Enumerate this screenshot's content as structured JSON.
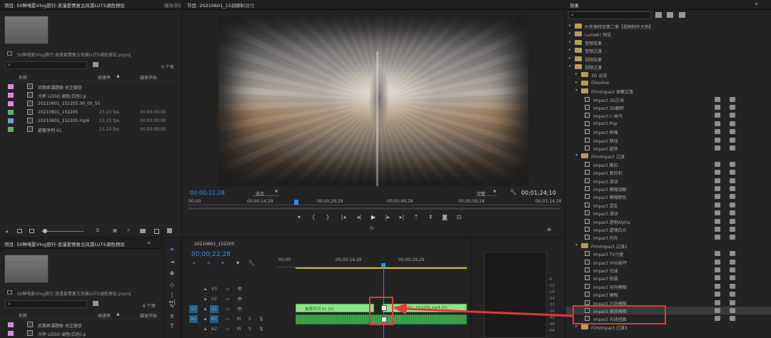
{
  "project": {
    "tab_project": "项目: 50种电影Vlog旅行·浪漫爱情复古风景LUTS调色预设",
    "tab_media": "媒体浏览器",
    "file": "50种电影Vlog旅行·浪漫爱情复古风景LUTS调色预设.prproj",
    "count": "6 个项",
    "columns": {
      "name": "名称",
      "frame_rate": "帧速率",
      "start": "媒体开始"
    },
    "items": [
      {
        "color": "#d78ad6",
        "icon": "file-icon",
        "name": "后期君课题联·关注微信",
        "rate": "",
        "start": ""
      },
      {
        "color": "#d78ad6",
        "icon": "file-icon",
        "name": "大杯 LOGO 调色(白色).p",
        "rate": "",
        "start": ""
      },
      {
        "color": "#d78ad6",
        "icon": "file-icon",
        "name": "20210601_152205.00_00_55",
        "rate": "",
        "start": ""
      },
      {
        "color": "#56b864",
        "icon": "sequence-icon",
        "name": "20210601_152205",
        "rate": "23.23 fps",
        "start": "00;00;00;00"
      },
      {
        "color": "#6aa0d8",
        "icon": "video-icon",
        "name": "20210601_152205.mp4",
        "rate": "23.23 fps",
        "start": "00;00;00;00"
      },
      {
        "color": "#56b864",
        "icon": "sequence-icon",
        "name": "嵌套序列 01",
        "rate": "23.23 fps",
        "start": "00;00;00;00"
      }
    ]
  },
  "program": {
    "tab_program": "节目: 20210601_152205",
    "tab_meta": "旧素材属性",
    "timecode": "00;00;22;28",
    "fit": "适合",
    "quality": "完整",
    "duration": "00;01;24;10",
    "ruler": [
      "00;00",
      "00;00;14;29",
      "00;00;29;29",
      "00;00;44;28",
      "00;00;59;28",
      "00;01;14;29"
    ]
  },
  "project2": {
    "tab": "项目: 50种电影Vlog旅行·浪漫爱情复古风景LUTS调色预设",
    "file": "50种电影Vlog旅行·浪漫爱情复古风景LUTS调色预设.prproj",
    "count": "6 个项",
    "columns": {
      "name": "名称",
      "frame_rate": "帧速率",
      "start": "媒体开始"
    },
    "items": [
      {
        "color": "#d78ad6",
        "name": "后期君课题联·关注微信"
      },
      {
        "color": "#d78ad6",
        "name": "大杯 LOGO 调色(白色).p"
      }
    ]
  },
  "timeline": {
    "tab": "20210601_152205",
    "timecode": "00;00;22;28",
    "ruler": [
      "00;00",
      "00;00;14;29",
      "00;00;29;29"
    ],
    "tracks": [
      {
        "id": "V3",
        "target": ""
      },
      {
        "id": "V2",
        "target": ""
      },
      {
        "id": "V1",
        "target": "V1"
      },
      {
        "id": "A1",
        "target": "A1"
      },
      {
        "id": "A2",
        "target": ""
      }
    ],
    "clip_label": "嵌套序列 01 [V]",
    "clip_label2": "20210601_152205.mp4 [V]",
    "meter": [
      "-6",
      "-12",
      "-18",
      "-24",
      "-30",
      "-36",
      "-42",
      "-48",
      "-54"
    ]
  },
  "effects": {
    "title": "效果",
    "tree": [
      {
        "level": 0,
        "label": "Pr先锋特效第二季【视频制作大师】"
      },
      {
        "level": 0,
        "label": "Lumetri 预设"
      },
      {
        "level": 0,
        "label": "音频效果"
      },
      {
        "level": 0,
        "label": "音频过渡"
      },
      {
        "level": 0,
        "label": "视频效果"
      },
      {
        "level": 0,
        "label": "视频过渡",
        "open": true
      },
      {
        "level": 1,
        "label": "3D 运动"
      },
      {
        "level": 1,
        "label": "Dissolve"
      },
      {
        "level": 1,
        "label": "FilmImpact 弹簧过渡",
        "open": true
      },
      {
        "level": 2,
        "label": "Impact 3D方块"
      },
      {
        "level": 2,
        "label": "Impact 3D翻转"
      },
      {
        "level": 2,
        "label": "Impact C-曲马"
      },
      {
        "level": 2,
        "label": "Impact Pop"
      },
      {
        "level": 2,
        "label": "Impact 伸缩"
      },
      {
        "level": 2,
        "label": "Impact 移动"
      },
      {
        "level": 2,
        "label": "Impact 旋转"
      },
      {
        "level": 1,
        "label": "FilmImpact 过渡",
        "open": true
      },
      {
        "level": 2,
        "label": "Impact 推拉"
      },
      {
        "level": 2,
        "label": "Impact 复印机"
      },
      {
        "level": 2,
        "label": "Impact 滚动"
      },
      {
        "level": 2,
        "label": "Impact 模糊溶解"
      },
      {
        "level": 2,
        "label": "Impact 模糊颜色"
      },
      {
        "level": 2,
        "label": "Impact 混乱"
      },
      {
        "level": 2,
        "label": "Impact 滑动"
      },
      {
        "level": 2,
        "label": "Impact 透明Alpha"
      },
      {
        "level": 2,
        "label": "Impact 透镜白光"
      },
      {
        "level": 2,
        "label": "Impact 闪光"
      },
      {
        "level": 1,
        "label": "FilmImpact 过渡2",
        "open": true
      },
      {
        "level": 2,
        "label": "Impact TV力量"
      },
      {
        "level": 2,
        "label": "Impact VHS损坏"
      },
      {
        "level": 2,
        "label": "Impact 光球"
      },
      {
        "level": 2,
        "label": "Impact 拍摄"
      },
      {
        "level": 2,
        "label": "Impact 径向模糊"
      },
      {
        "level": 2,
        "label": "Impact 模糊"
      },
      {
        "level": 2,
        "label": "Impact 方向模糊"
      },
      {
        "level": 2,
        "label": "Impact 缩放模糊",
        "highlight": true
      },
      {
        "level": 2,
        "label": "Impact 光线扭曲"
      },
      {
        "level": 1,
        "label": "FilmImpact 过渡3"
      }
    ]
  },
  "colors": {
    "accent": "#2d8ceb",
    "callout": "#e8353a",
    "clip": "#8ae58a",
    "audio": "#3fa84f"
  }
}
